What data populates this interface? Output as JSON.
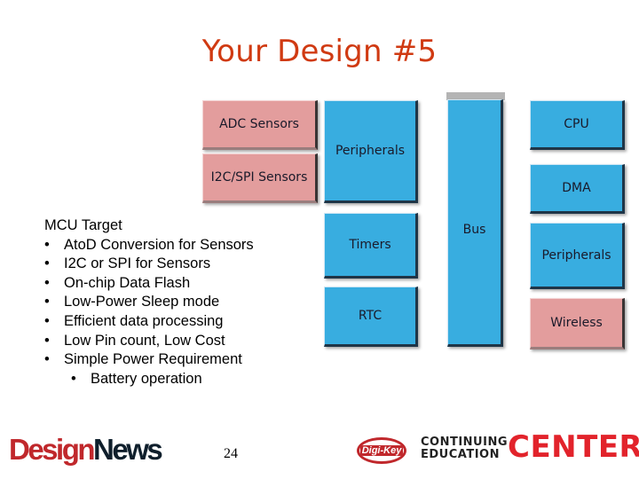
{
  "slide": {
    "title": "Your Design #5",
    "page_number": "24"
  },
  "diagram": {
    "blocks": {
      "adc_sensors": "ADC Sensors",
      "i2c_spi_sensors": "I2C/SPI Sensors",
      "peripherals_left": "Peripherals",
      "timers": "Timers",
      "rtc": "RTC",
      "bus": "Bus",
      "cpu": "CPU",
      "dma": "DMA",
      "peripherals_right": "Peripherals",
      "wireless": "Wireless"
    },
    "colors": {
      "highlight_pink": "#e39d9d",
      "standard_blue": "#38ade0",
      "title_red": "#d03a12"
    }
  },
  "mcu_target": {
    "heading": "MCU Target",
    "bullets": [
      "AtoD Conversion for Sensors",
      "I2C or SPI for Sensors",
      "On-chip Data Flash",
      "Low-Power Sleep mode",
      "Efficient data processing",
      "Low Pin count, Low Cost",
      "Simple Power Requirement"
    ],
    "sub_bullets": [
      "Battery operation"
    ],
    "bullet_glyph": "•"
  },
  "footer": {
    "designnews_part1": "Design",
    "designnews_part2": "News",
    "digikey_logo": "Digi-Key",
    "continuing": "CONTINUING",
    "education": "EDUCATION",
    "center": "CENTER"
  }
}
